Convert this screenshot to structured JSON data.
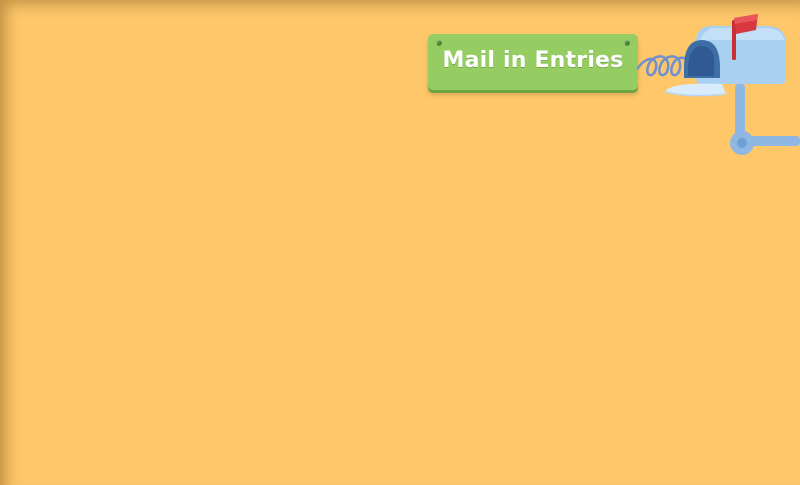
{
  "sign": {
    "label": "Mail in Entries"
  },
  "icons": {
    "mailbox": "mailbox-icon",
    "flag": "flag-icon",
    "spring": "spring-icon"
  },
  "colors": {
    "background": "#fdc76a",
    "sign": "#96cd62",
    "mailbox": "#a9d0f0",
    "mailbox_opening": "#3e6ea8",
    "flag": "#d8383f"
  }
}
